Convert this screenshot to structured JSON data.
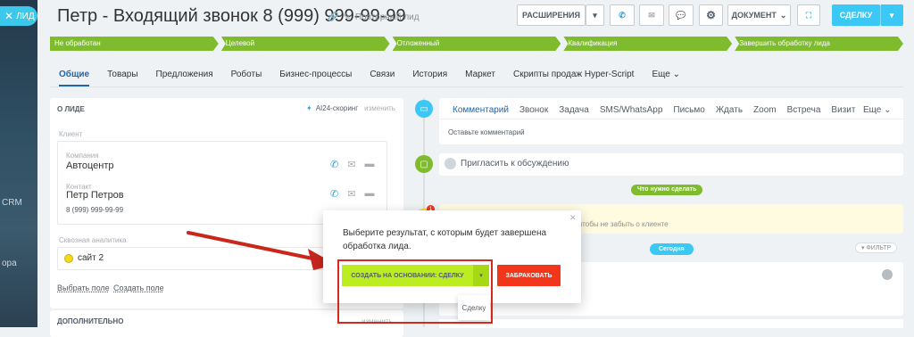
{
  "sidebar": {
    "tab_label": "ЛИД",
    "close_glyph": "✕",
    "crm_label": "CRM",
    "partial_label": "ора"
  },
  "header": {
    "title": "Петр - Входящий звонок 8 (999) 999-99-99",
    "repeat_label": "Повторный лид",
    "extensions_label": "РАСШИРЕНИЯ",
    "document_label": "ДОКУМЕНТ",
    "deal_label": "СДЕЛКУ"
  },
  "stages": [
    "Не обработан",
    "Целевой",
    "Отложенный",
    "Квалификация",
    "Завершить обработку лида"
  ],
  "tabs": [
    "Общие",
    "Товары",
    "Предложения",
    "Роботы",
    "Бизнес-процессы",
    "Связи",
    "История",
    "Маркет",
    "Скрипты продаж Hyper-Script",
    "Еще"
  ],
  "about": {
    "heading": "О ЛИДЕ",
    "scoring": "AI24-скоринг",
    "edit": "изменить",
    "client_label": "Клиент",
    "company_label": "Компания",
    "company_value": "Автоцентр",
    "contact_label": "Контакт",
    "contact_value": "Петр Петров",
    "contact_phone": "8 (999) 999-99-99",
    "analytics_label": "Сквозная аналитика",
    "analytics_value": "сайт 2",
    "select_field": "Выбрать поле",
    "create_field": "Создать поле",
    "more_heading": "ДОПОЛНИТЕЛЬНО",
    "more_edit": "изменить"
  },
  "editor": {
    "tabs": [
      "Комментарий",
      "Звонок",
      "Задача",
      "SMS/WhatsApp",
      "Письмо",
      "Ждать",
      "Zoom",
      "Встреча",
      "Визит",
      "Еще"
    ],
    "placeholder": "Оставьте комментарий"
  },
  "invite_text": "Пригласить к обсуждению",
  "todo_badge": "Что нужно сделать",
  "todo_text": "чтобы не забыть о клиенте",
  "today_badge": "Сегодня",
  "filter_label": "ФИЛЬТР",
  "popup": {
    "text": "Выберите результат, с которым будет завершена обработка лида.",
    "create_button": "СОЗДАТЬ НА ОСНОВАНИИ: СДЕЛКУ",
    "reject_button": "ЗАБРАКОВАТЬ",
    "dropdown_option": "Сделку"
  },
  "colors": {
    "accent": "#3bc8f5",
    "stage_green": "#7ebc2d",
    "reject_red": "#f1361b",
    "create_green": "#bbed21",
    "annotation_red": "#d42a1e"
  }
}
